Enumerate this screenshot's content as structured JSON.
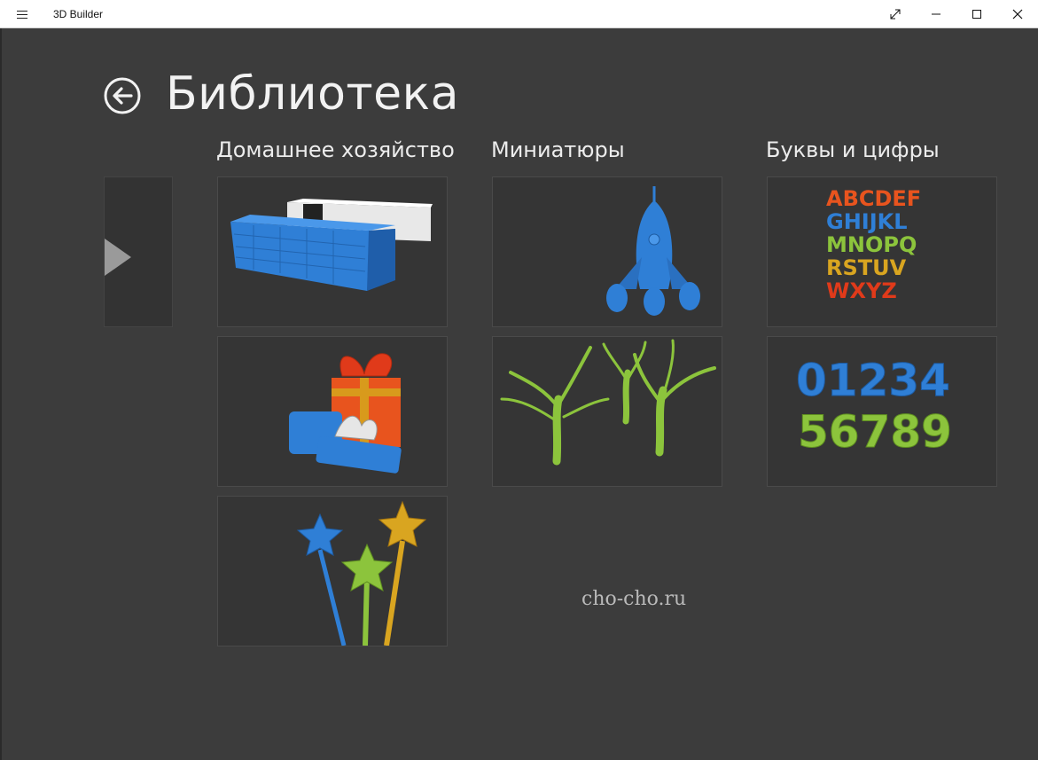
{
  "window": {
    "app_title": "3D Builder",
    "menu_icon": "hamburger-icon",
    "buttons": [
      "fullscreen-icon",
      "minimize-icon",
      "maximize-icon",
      "close-icon"
    ]
  },
  "header": {
    "back_icon": "back-arrow-icon",
    "title": "Библиотека"
  },
  "sections": [
    {
      "title": "Домашнее хозяйство",
      "items": [
        "speaker-model",
        "gift-box-model",
        "star-wands-model"
      ]
    },
    {
      "title": "Миниатюры",
      "items": [
        "rocket-model",
        "trees-model"
      ]
    },
    {
      "title": "Буквы и цифры",
      "items": [
        "letters-model",
        "numbers-model"
      ]
    }
  ],
  "tiles_text": {
    "letters": [
      "ABCDEF",
      "GHIJKL",
      "MNOPQ",
      "RSTUV",
      "WXYZ"
    ],
    "numbers": [
      "01234",
      "56789"
    ]
  },
  "watermark": "cho-cho.ru",
  "colors": {
    "background": "#3c3c3c",
    "tile": "#353535",
    "blue": "#2f7fd6",
    "green": "#8cc43c",
    "orange": "#e8541e",
    "yellow": "#d9a520"
  }
}
